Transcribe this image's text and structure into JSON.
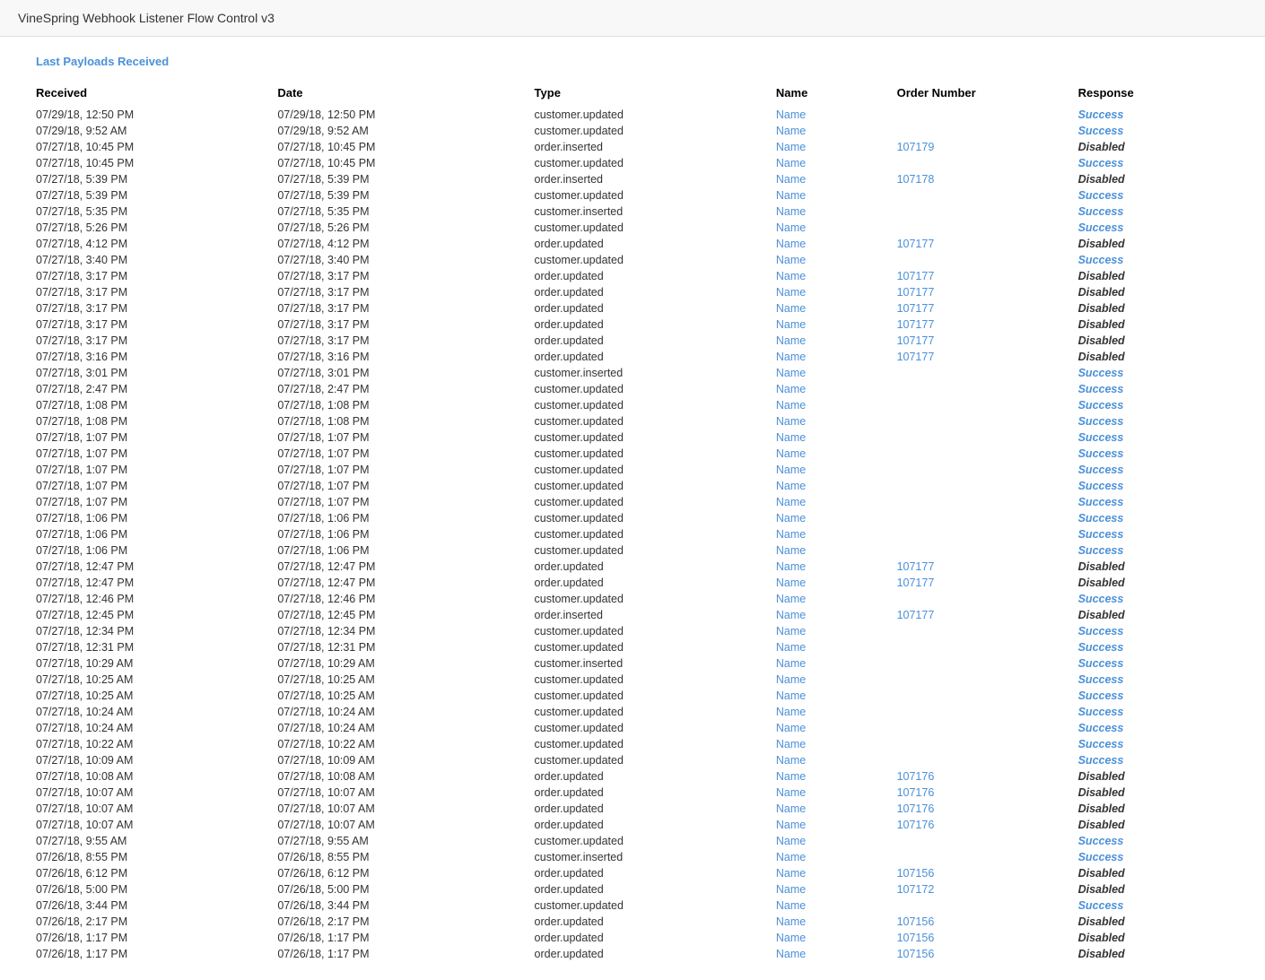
{
  "header": {
    "title": "VineSpring Webhook Listener Flow Control v3"
  },
  "section": {
    "title": "Last Payloads Received"
  },
  "table": {
    "columns": [
      "Received",
      "Date",
      "Type",
      "Name",
      "Order Number",
      "Response"
    ],
    "rows": [
      {
        "received": "07/29/18, 12:50 PM",
        "date": "07/29/18, 12:50 PM",
        "type": "customer.updated",
        "name": "Name",
        "order": "",
        "response": "Success"
      },
      {
        "received": "07/29/18, 9:52 AM",
        "date": "07/29/18, 9:52 AM",
        "type": "customer.updated",
        "name": "Name",
        "order": "",
        "response": "Success"
      },
      {
        "received": "07/27/18, 10:45 PM",
        "date": "07/27/18, 10:45 PM",
        "type": "order.inserted",
        "name": "Name",
        "order": "107179",
        "response": "Disabled"
      },
      {
        "received": "07/27/18, 10:45 PM",
        "date": "07/27/18, 10:45 PM",
        "type": "customer.updated",
        "name": "Name",
        "order": "",
        "response": "Success"
      },
      {
        "received": "07/27/18, 5:39 PM",
        "date": "07/27/18, 5:39 PM",
        "type": "order.inserted",
        "name": "Name",
        "order": "107178",
        "response": "Disabled"
      },
      {
        "received": "07/27/18, 5:39 PM",
        "date": "07/27/18, 5:39 PM",
        "type": "customer.updated",
        "name": "Name",
        "order": "",
        "response": "Success"
      },
      {
        "received": "07/27/18, 5:35 PM",
        "date": "07/27/18, 5:35 PM",
        "type": "customer.inserted",
        "name": "Name",
        "order": "",
        "response": "Success"
      },
      {
        "received": "07/27/18, 5:26 PM",
        "date": "07/27/18, 5:26 PM",
        "type": "customer.updated",
        "name": "Name",
        "order": "",
        "response": "Success"
      },
      {
        "received": "07/27/18, 4:12 PM",
        "date": "07/27/18, 4:12 PM",
        "type": "order.updated",
        "name": "Name",
        "order": "107177",
        "response": "Disabled"
      },
      {
        "received": "07/27/18, 3:40 PM",
        "date": "07/27/18, 3:40 PM",
        "type": "customer.updated",
        "name": "Name",
        "order": "",
        "response": "Success"
      },
      {
        "received": "07/27/18, 3:17 PM",
        "date": "07/27/18, 3:17 PM",
        "type": "order.updated",
        "name": "Name",
        "order": "107177",
        "response": "Disabled"
      },
      {
        "received": "07/27/18, 3:17 PM",
        "date": "07/27/18, 3:17 PM",
        "type": "order.updated",
        "name": "Name",
        "order": "107177",
        "response": "Disabled"
      },
      {
        "received": "07/27/18, 3:17 PM",
        "date": "07/27/18, 3:17 PM",
        "type": "order.updated",
        "name": "Name",
        "order": "107177",
        "response": "Disabled"
      },
      {
        "received": "07/27/18, 3:17 PM",
        "date": "07/27/18, 3:17 PM",
        "type": "order.updated",
        "name": "Name",
        "order": "107177",
        "response": "Disabled"
      },
      {
        "received": "07/27/18, 3:17 PM",
        "date": "07/27/18, 3:17 PM",
        "type": "order.updated",
        "name": "Name",
        "order": "107177",
        "response": "Disabled"
      },
      {
        "received": "07/27/18, 3:16 PM",
        "date": "07/27/18, 3:16 PM",
        "type": "order.updated",
        "name": "Name",
        "order": "107177",
        "response": "Disabled"
      },
      {
        "received": "07/27/18, 3:01 PM",
        "date": "07/27/18, 3:01 PM",
        "type": "customer.inserted",
        "name": "Name",
        "order": "",
        "response": "Success"
      },
      {
        "received": "07/27/18, 2:47 PM",
        "date": "07/27/18, 2:47 PM",
        "type": "customer.updated",
        "name": "Name",
        "order": "",
        "response": "Success"
      },
      {
        "received": "07/27/18, 1:08 PM",
        "date": "07/27/18, 1:08 PM",
        "type": "customer.updated",
        "name": "Name",
        "order": "",
        "response": "Success"
      },
      {
        "received": "07/27/18, 1:08 PM",
        "date": "07/27/18, 1:08 PM",
        "type": "customer.updated",
        "name": "Name",
        "order": "",
        "response": "Success"
      },
      {
        "received": "07/27/18, 1:07 PM",
        "date": "07/27/18, 1:07 PM",
        "type": "customer.updated",
        "name": "Name",
        "order": "",
        "response": "Success"
      },
      {
        "received": "07/27/18, 1:07 PM",
        "date": "07/27/18, 1:07 PM",
        "type": "customer.updated",
        "name": "Name",
        "order": "",
        "response": "Success"
      },
      {
        "received": "07/27/18, 1:07 PM",
        "date": "07/27/18, 1:07 PM",
        "type": "customer.updated",
        "name": "Name",
        "order": "",
        "response": "Success"
      },
      {
        "received": "07/27/18, 1:07 PM",
        "date": "07/27/18, 1:07 PM",
        "type": "customer.updated",
        "name": "Name",
        "order": "",
        "response": "Success"
      },
      {
        "received": "07/27/18, 1:07 PM",
        "date": "07/27/18, 1:07 PM",
        "type": "customer.updated",
        "name": "Name",
        "order": "",
        "response": "Success"
      },
      {
        "received": "07/27/18, 1:06 PM",
        "date": "07/27/18, 1:06 PM",
        "type": "customer.updated",
        "name": "Name",
        "order": "",
        "response": "Success"
      },
      {
        "received": "07/27/18, 1:06 PM",
        "date": "07/27/18, 1:06 PM",
        "type": "customer.updated",
        "name": "Name",
        "order": "",
        "response": "Success"
      },
      {
        "received": "07/27/18, 1:06 PM",
        "date": "07/27/18, 1:06 PM",
        "type": "customer.updated",
        "name": "Name",
        "order": "",
        "response": "Success"
      },
      {
        "received": "07/27/18, 12:47 PM",
        "date": "07/27/18, 12:47 PM",
        "type": "order.updated",
        "name": "Name",
        "order": "107177",
        "response": "Disabled"
      },
      {
        "received": "07/27/18, 12:47 PM",
        "date": "07/27/18, 12:47 PM",
        "type": "order.updated",
        "name": "Name",
        "order": "107177",
        "response": "Disabled"
      },
      {
        "received": "07/27/18, 12:46 PM",
        "date": "07/27/18, 12:46 PM",
        "type": "customer.updated",
        "name": "Name",
        "order": "",
        "response": "Success"
      },
      {
        "received": "07/27/18, 12:45 PM",
        "date": "07/27/18, 12:45 PM",
        "type": "order.inserted",
        "name": "Name",
        "order": "107177",
        "response": "Disabled"
      },
      {
        "received": "07/27/18, 12:34 PM",
        "date": "07/27/18, 12:34 PM",
        "type": "customer.updated",
        "name": "Name",
        "order": "",
        "response": "Success"
      },
      {
        "received": "07/27/18, 12:31 PM",
        "date": "07/27/18, 12:31 PM",
        "type": "customer.updated",
        "name": "Name",
        "order": "",
        "response": "Success"
      },
      {
        "received": "07/27/18, 10:29 AM",
        "date": "07/27/18, 10:29 AM",
        "type": "customer.inserted",
        "name": "Name",
        "order": "",
        "response": "Success"
      },
      {
        "received": "07/27/18, 10:25 AM",
        "date": "07/27/18, 10:25 AM",
        "type": "customer.updated",
        "name": "Name",
        "order": "",
        "response": "Success"
      },
      {
        "received": "07/27/18, 10:25 AM",
        "date": "07/27/18, 10:25 AM",
        "type": "customer.updated",
        "name": "Name",
        "order": "",
        "response": "Success"
      },
      {
        "received": "07/27/18, 10:24 AM",
        "date": "07/27/18, 10:24 AM",
        "type": "customer.updated",
        "name": "Name",
        "order": "",
        "response": "Success"
      },
      {
        "received": "07/27/18, 10:24 AM",
        "date": "07/27/18, 10:24 AM",
        "type": "customer.updated",
        "name": "Name",
        "order": "",
        "response": "Success"
      },
      {
        "received": "07/27/18, 10:22 AM",
        "date": "07/27/18, 10:22 AM",
        "type": "customer.updated",
        "name": "Name",
        "order": "",
        "response": "Success"
      },
      {
        "received": "07/27/18, 10:09 AM",
        "date": "07/27/18, 10:09 AM",
        "type": "customer.updated",
        "name": "Name",
        "order": "",
        "response": "Success"
      },
      {
        "received": "07/27/18, 10:08 AM",
        "date": "07/27/18, 10:08 AM",
        "type": "order.updated",
        "name": "Name",
        "order": "107176",
        "response": "Disabled"
      },
      {
        "received": "07/27/18, 10:07 AM",
        "date": "07/27/18, 10:07 AM",
        "type": "order.updated",
        "name": "Name",
        "order": "107176",
        "response": "Disabled"
      },
      {
        "received": "07/27/18, 10:07 AM",
        "date": "07/27/18, 10:07 AM",
        "type": "order.updated",
        "name": "Name",
        "order": "107176",
        "response": "Disabled"
      },
      {
        "received": "07/27/18, 10:07 AM",
        "date": "07/27/18, 10:07 AM",
        "type": "order.updated",
        "name": "Name",
        "order": "107176",
        "response": "Disabled"
      },
      {
        "received": "07/27/18, 9:55 AM",
        "date": "07/27/18, 9:55 AM",
        "type": "customer.updated",
        "name": "Name",
        "order": "",
        "response": "Success"
      },
      {
        "received": "07/26/18, 8:55 PM",
        "date": "07/26/18, 8:55 PM",
        "type": "customer.inserted",
        "name": "Name",
        "order": "",
        "response": "Success"
      },
      {
        "received": "07/26/18, 6:12 PM",
        "date": "07/26/18, 6:12 PM",
        "type": "order.updated",
        "name": "Name",
        "order": "107156",
        "response": "Disabled"
      },
      {
        "received": "07/26/18, 5:00 PM",
        "date": "07/26/18, 5:00 PM",
        "type": "order.updated",
        "name": "Name",
        "order": "107172",
        "response": "Disabled"
      },
      {
        "received": "07/26/18, 3:44 PM",
        "date": "07/26/18, 3:44 PM",
        "type": "customer.updated",
        "name": "Name",
        "order": "",
        "response": "Success"
      },
      {
        "received": "07/26/18, 2:17 PM",
        "date": "07/26/18, 2:17 PM",
        "type": "order.updated",
        "name": "Name",
        "order": "107156",
        "response": "Disabled"
      },
      {
        "received": "07/26/18, 1:17 PM",
        "date": "07/26/18, 1:17 PM",
        "type": "order.updated",
        "name": "Name",
        "order": "107156",
        "response": "Disabled"
      },
      {
        "received": "07/26/18, 1:17 PM",
        "date": "07/26/18, 1:17 PM",
        "type": "order.updated",
        "name": "Name",
        "order": "107156",
        "response": "Disabled"
      }
    ]
  }
}
